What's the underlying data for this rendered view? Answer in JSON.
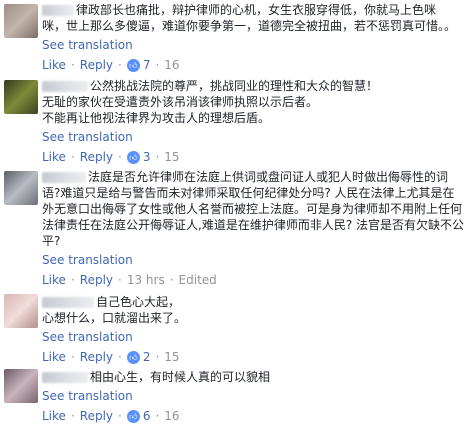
{
  "ui": {
    "see_translation": "See translation",
    "like": "Like",
    "reply": "Reply",
    "dot": "·",
    "like_icon": "thumbs-up-icon"
  },
  "comments": [
    {
      "text": "律政部长也痛批，辩护律师的心机，女生衣服穿得低，你就马上色咪\n咪，世上那么多傻逼，难道你要争第一，道德完全被扭曲，若不惩罚真可惜。。",
      "likes": "7",
      "replies": "16",
      "time": "",
      "edited": ""
    },
    {
      "text": "公然挑战法院的尊严，挑战同业的理性和大众的智慧！\n无耻的家伙在受遣责外该吊消该律师执照以示后者。\n不能再让他视法律界为攻击人的理想后盾。",
      "likes": "3",
      "replies": "15",
      "time": "",
      "edited": ""
    },
    {
      "text": "法庭是否允许律师在法庭上供词或盘问证人或犯人时做出侮辱性的词\n语?难道只是给与警告而未对律师采取任何纪律处分吗? 人民在法律上尤其是在\n外无意口出侮辱了女性或他人名誉而被控上法庭。可是身为律师却不用附上任何\n法律责任在法庭公开侮辱证人,难道是在维护律师而非人民? 法官是否有欠缺不公\n平?",
      "likes": "",
      "replies": "",
      "time": "13 hrs",
      "edited": "Edited"
    },
    {
      "text": "自己色心大起，\n心想什么，口就溜出来了。",
      "likes": "2",
      "replies": "15",
      "time": "",
      "edited": ""
    },
    {
      "text": "相由心生，有时候人真的可以貌相",
      "likes": "6",
      "replies": "16",
      "time": "",
      "edited": ""
    }
  ]
}
